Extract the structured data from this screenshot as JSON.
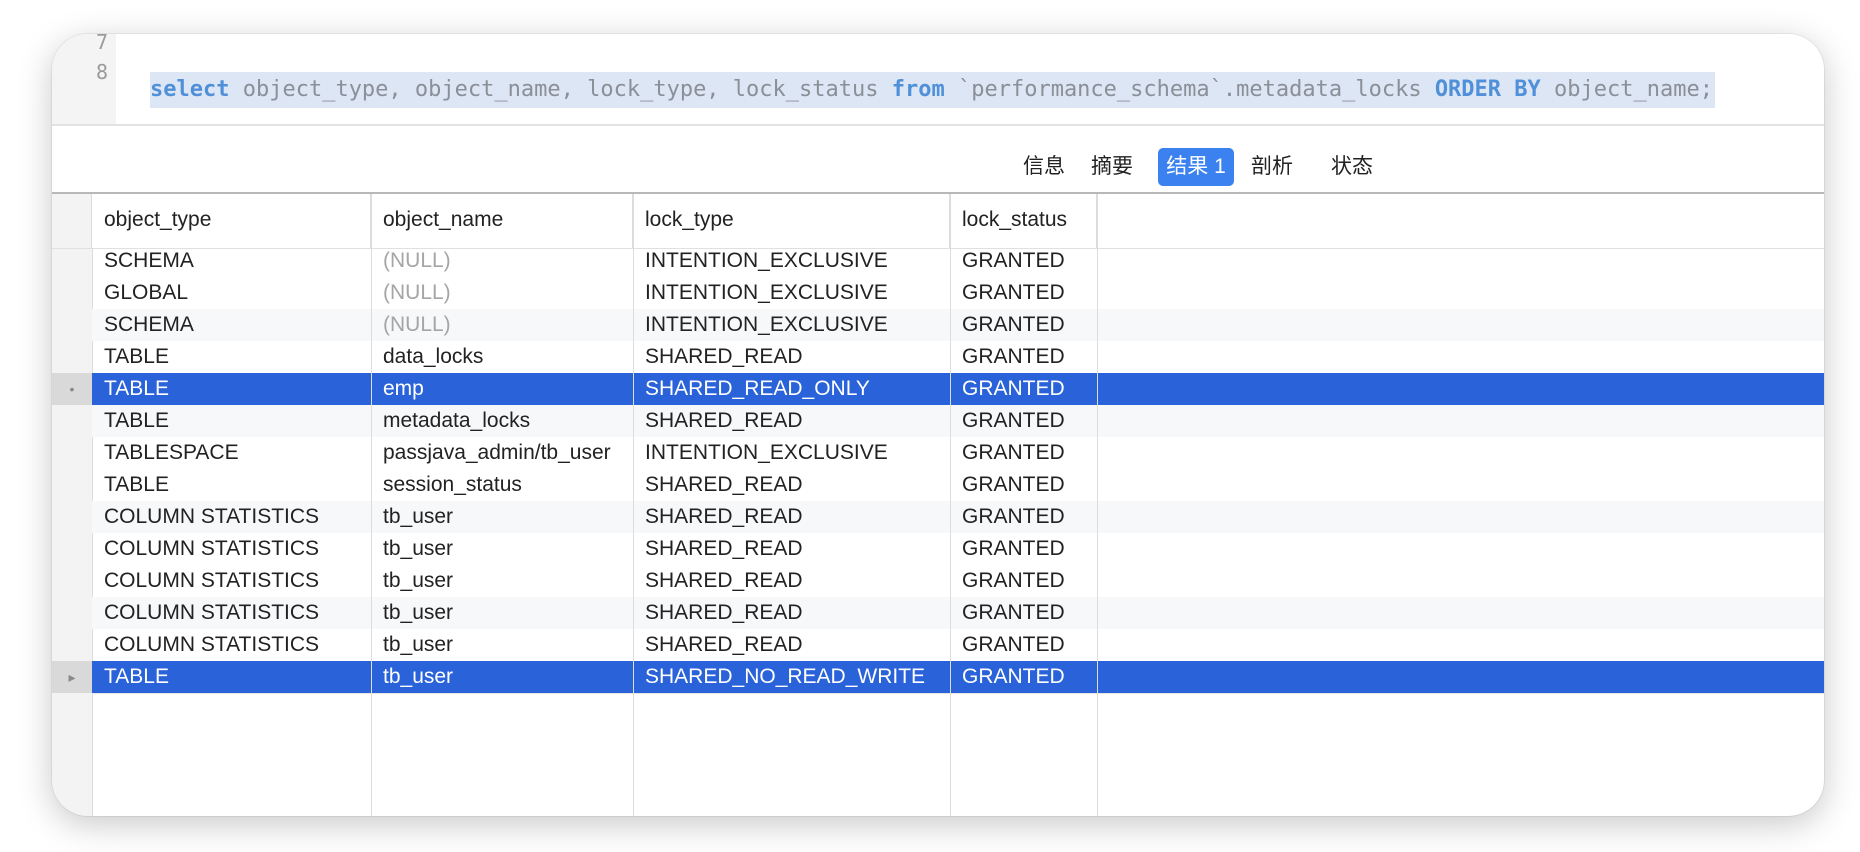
{
  "editor": {
    "line_numbers": [
      "7",
      "8"
    ],
    "code_tokens": [
      {
        "text": "select",
        "kw": true
      },
      {
        "text": " object_type, object_name, lock_type, lock_status ",
        "kw": false
      },
      {
        "text": "from",
        "kw": true
      },
      {
        "text": " `performance_schema`.metadata_locks ",
        "kw": false
      },
      {
        "text": "ORDER BY",
        "kw": true
      },
      {
        "text": " object_name;",
        "kw": false
      }
    ]
  },
  "tabs": [
    {
      "label": "信息",
      "active": false
    },
    {
      "label": "摘要",
      "active": false
    },
    {
      "label": "结果 1",
      "active": true
    },
    {
      "label": "剖析",
      "active": false
    },
    {
      "label": "状态",
      "active": false
    }
  ],
  "grid": {
    "columns": [
      "object_type",
      "object_name",
      "lock_type",
      "lock_status"
    ],
    "rows": [
      {
        "object_type": "SCHEMA",
        "object_name": "(NULL)",
        "lock_type": "INTENTION_EXCLUSIVE",
        "lock_status": "GRANTED",
        "null_name": true,
        "selected": false,
        "marker": ""
      },
      {
        "object_type": "GLOBAL",
        "object_name": "(NULL)",
        "lock_type": "INTENTION_EXCLUSIVE",
        "lock_status": "GRANTED",
        "null_name": true,
        "selected": false,
        "marker": ""
      },
      {
        "object_type": "SCHEMA",
        "object_name": "(NULL)",
        "lock_type": "INTENTION_EXCLUSIVE",
        "lock_status": "GRANTED",
        "null_name": true,
        "selected": false,
        "marker": ""
      },
      {
        "object_type": "TABLE",
        "object_name": "data_locks",
        "lock_type": "SHARED_READ",
        "lock_status": "GRANTED",
        "null_name": false,
        "selected": false,
        "marker": ""
      },
      {
        "object_type": "TABLE",
        "object_name": "emp",
        "lock_type": "SHARED_READ_ONLY",
        "lock_status": "GRANTED",
        "null_name": false,
        "selected": true,
        "marker": "•"
      },
      {
        "object_type": "TABLE",
        "object_name": "metadata_locks",
        "lock_type": "SHARED_READ",
        "lock_status": "GRANTED",
        "null_name": false,
        "selected": false,
        "marker": ""
      },
      {
        "object_type": "TABLESPACE",
        "object_name": "passjava_admin/tb_user",
        "lock_type": "INTENTION_EXCLUSIVE",
        "lock_status": "GRANTED",
        "null_name": false,
        "selected": false,
        "marker": ""
      },
      {
        "object_type": "TABLE",
        "object_name": "session_status",
        "lock_type": "SHARED_READ",
        "lock_status": "GRANTED",
        "null_name": false,
        "selected": false,
        "marker": ""
      },
      {
        "object_type": "COLUMN STATISTICS",
        "object_name": "tb_user",
        "lock_type": "SHARED_READ",
        "lock_status": "GRANTED",
        "null_name": false,
        "selected": false,
        "marker": ""
      },
      {
        "object_type": "COLUMN STATISTICS",
        "object_name": "tb_user",
        "lock_type": "SHARED_READ",
        "lock_status": "GRANTED",
        "null_name": false,
        "selected": false,
        "marker": ""
      },
      {
        "object_type": "COLUMN STATISTICS",
        "object_name": "tb_user",
        "lock_type": "SHARED_READ",
        "lock_status": "GRANTED",
        "null_name": false,
        "selected": false,
        "marker": ""
      },
      {
        "object_type": "COLUMN STATISTICS",
        "object_name": "tb_user",
        "lock_type": "SHARED_READ",
        "lock_status": "GRANTED",
        "null_name": false,
        "selected": false,
        "marker": ""
      },
      {
        "object_type": "COLUMN STATISTICS",
        "object_name": "tb_user",
        "lock_type": "SHARED_READ",
        "lock_status": "GRANTED",
        "null_name": false,
        "selected": false,
        "marker": ""
      },
      {
        "object_type": "TABLE",
        "object_name": "tb_user",
        "lock_type": "SHARED_NO_READ_WRITE",
        "lock_status": "GRANTED",
        "null_name": false,
        "selected": true,
        "marker": "▸"
      }
    ]
  },
  "colors": {
    "accent": "#3b82f0",
    "selection": "#2962d9",
    "keyword": "#4f90d9",
    "null_text": "#a5a5a5"
  }
}
